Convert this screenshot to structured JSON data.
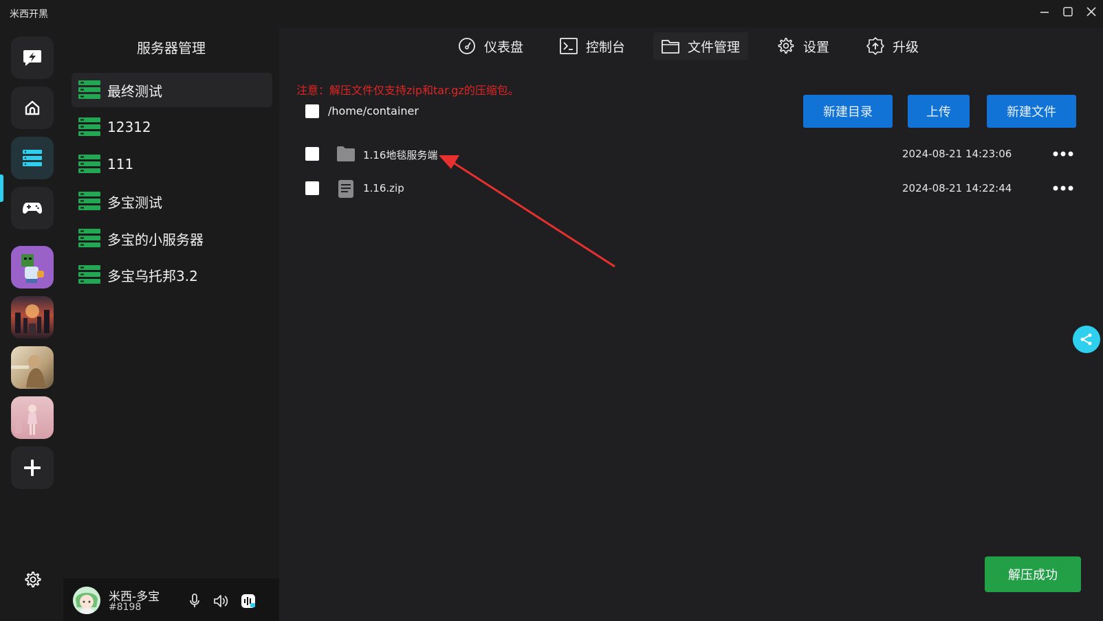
{
  "window": {
    "title": "米西开黑"
  },
  "sidebar": {
    "title": "服务器管理",
    "servers": [
      {
        "name": "最终测试"
      },
      {
        "name": "12312"
      },
      {
        "name": "111"
      },
      {
        "name": "多宝测试"
      },
      {
        "name": "多宝的小服务器"
      },
      {
        "name": "多宝乌托邦3.2"
      }
    ]
  },
  "user": {
    "name": "米西-多宝",
    "tag": "#8198"
  },
  "nav": [
    {
      "label": "仪表盘",
      "icon": "dashboard-icon"
    },
    {
      "label": "控制台",
      "icon": "terminal-icon"
    },
    {
      "label": "文件管理",
      "icon": "folder-icon"
    },
    {
      "label": "设置",
      "icon": "gear-icon"
    },
    {
      "label": "升级",
      "icon": "upgrade-icon"
    }
  ],
  "files": {
    "notice": "注意：解压文件仅支持zip和tar.gz的压缩包。",
    "path": "/home/container",
    "buttons": {
      "new_dir": "新建目录",
      "upload": "上传",
      "new_file": "新建文件"
    },
    "items": [
      {
        "name": "1.16地毯服务端",
        "type": "folder",
        "date": "2024-08-21 14:23:06"
      },
      {
        "name": "1.16.zip",
        "type": "file",
        "date": "2024-08-21 14:22:44"
      }
    ]
  },
  "toast": {
    "text": "解压成功"
  },
  "colors": {
    "accent": "#2fd0ef",
    "primary": "#1273d6",
    "success": "#23a047",
    "warning": "#e02424",
    "server_icon": "#22a853"
  }
}
